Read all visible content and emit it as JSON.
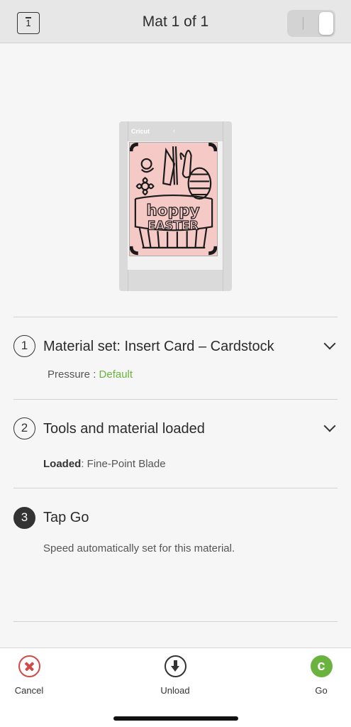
{
  "header": {
    "mat_badge": "1",
    "title": "Mat 1 of 1"
  },
  "mat": {
    "brand": "Cricut",
    "art_text_1": "hoppy",
    "art_text_2": "EASTER",
    "art_fill_color": "#f5c9c6"
  },
  "steps": [
    {
      "number": "1",
      "title": "Material set: Insert Card –  Cardstock",
      "detail_label": "Pressure : ",
      "detail_value": "Default"
    },
    {
      "number": "2",
      "title": "Tools and material loaded",
      "detail_label": "Loaded",
      "detail_value": ": Fine-Point Blade"
    },
    {
      "number": "3",
      "title": "Tap Go",
      "detail_text": "Speed automatically set for this material."
    }
  ],
  "bottom_bar": {
    "cancel_label": "Cancel",
    "unload_label": "Unload",
    "go_label": "Go",
    "go_icon_glyph": "c"
  },
  "colors": {
    "accent_green": "#6bb33f",
    "cancel_red": "#d24a47",
    "header_bg": "#e7e7e7"
  }
}
